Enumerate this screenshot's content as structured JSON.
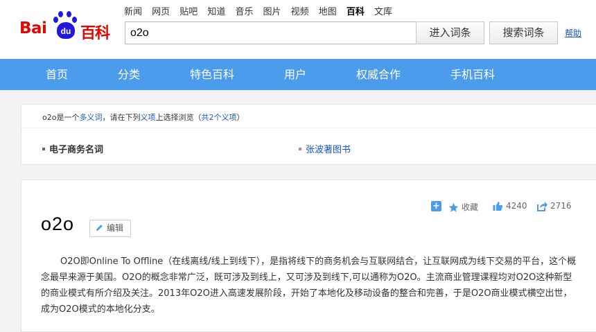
{
  "logo": {
    "wordmark_bai": "Bai",
    "wordmark_du": "du",
    "wordmark_cn": "百科"
  },
  "topnav": [
    "新闻",
    "网页",
    "贴吧",
    "知道",
    "音乐",
    "图片",
    "视频",
    "地图",
    "百科",
    "文库"
  ],
  "topnav_active": "百科",
  "search": {
    "value": "o2o",
    "enter_label": "进入词条",
    "search_label": "搜索词条",
    "help_label": "帮助"
  },
  "mainnav": [
    "首页",
    "分类",
    "特色百科",
    "用户",
    "权威合作",
    "手机百科"
  ],
  "polysemy": {
    "prefix": "o2o是一个",
    "link1": "多义词",
    "mid": "，请在下列",
    "link2": "义项",
    "suffix": "上选择浏览（",
    "link3": "共2个义项",
    "close": "）",
    "current_sense": "电子商务名词",
    "other_sense": "张波著图书"
  },
  "entry": {
    "title": "o2o",
    "edit_label": "编辑",
    "collect_label": "收藏",
    "like_count": "4240",
    "share_count": "2716",
    "paragraph": "O2O即Online To Offline（在线离线/线上到线下），是指将线下的商务机会与互联网结合，让互联网成为线下交易的平台，这个概念最早来源于美国。O2O的概念非常广泛，既可涉及到线上，又可涉及到线下,可以通称为O2O。主流商业管理课程均对O2O这种新型的商业模式有所介绍及关注。2013年O2O进入高速发展阶段，开始了本地化及移动设备的整合和完善，于是O2O商业模式横空出世，成为O2O模式的本地化分支。"
  },
  "colors": {
    "brand_red": "#e10601",
    "brand_blue": "#2319dc",
    "nav_blue": "#4c9ced",
    "link_blue": "#1356c5"
  },
  "icons": {
    "add": "plus-icon",
    "collect": "star-icon",
    "like": "thumbs-up-icon",
    "share": "share-icon",
    "edit": "pencil-icon"
  }
}
